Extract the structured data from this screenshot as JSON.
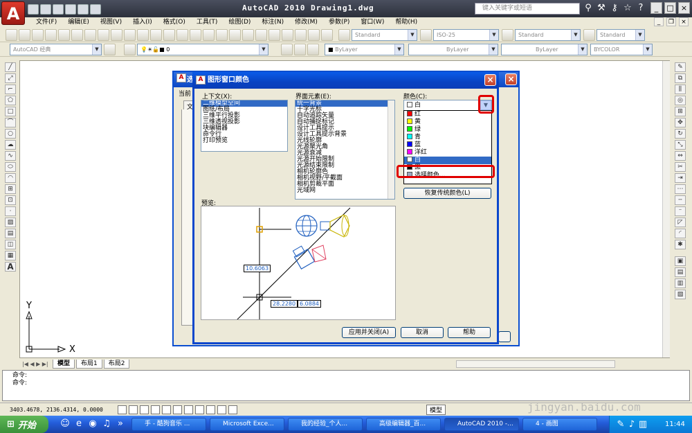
{
  "app": {
    "logo_letter": "A",
    "window_title": "AutoCAD 2010   Drawing1.dwg",
    "search_placeholder": "键入关键字或短语"
  },
  "menu": [
    "文件(F)",
    "编辑(E)",
    "视图(V)",
    "插入(I)",
    "格式(O)",
    "工具(T)",
    "绘图(D)",
    "标注(N)",
    "修改(M)",
    "参数(P)",
    "窗口(W)",
    "帮助(H)"
  ],
  "toolbar": {
    "text_style": "Standard",
    "dim_style": "ISO-25",
    "table_style": "Standard",
    "multileader_style": "Standard",
    "workspace": "AutoCAD 经典",
    "layer": "0",
    "color": "ByLayer",
    "linetype": "ByLayer",
    "lineweight": "ByLayer",
    "plotstyle": "BYCOLOR"
  },
  "layout_tabs": [
    "模型",
    "布局1",
    "布局2"
  ],
  "command_lines": [
    "命令:",
    "命令:"
  ],
  "status": {
    "coords": "3403.4678, 2136.4314, 0.0000",
    "model_label": "模型"
  },
  "axes": {
    "x": "X",
    "y": "Y"
  },
  "bg_dialog": {
    "title_fragment": "选",
    "label_fragment": "当前",
    "tab_fragment": "文"
  },
  "dialog": {
    "title": "图形窗口颜色",
    "context_label": "上下文(X):",
    "contexts": [
      "二维模型空间",
      "图纸/布局",
      "三维平行投影",
      "三维透视投影",
      "块编辑器",
      "命令行",
      "打印预览"
    ],
    "element_label": "界面元素(E):",
    "elements": [
      "统一背景",
      "十字光标",
      "自动追踪矢量",
      "自动捕捉标记",
      "设计工具提示",
      "设计工具提示背景",
      "光线轮廓",
      "光源聚光角",
      "光源衰减",
      "光源开始限制",
      "光源结束限制",
      "相机轮廓色",
      "相机视野/平截面",
      "相机剪裁平面",
      "光域网"
    ],
    "color_label": "颜色(C):",
    "current_color": "白",
    "color_options": [
      {
        "name": "红",
        "swatch": "#ff0000"
      },
      {
        "name": "黄",
        "swatch": "#ffff00"
      },
      {
        "name": "绿",
        "swatch": "#00ff00"
      },
      {
        "name": "青",
        "swatch": "#00ffff"
      },
      {
        "name": "蓝",
        "swatch": "#0000ff"
      },
      {
        "name": "洋红",
        "swatch": "#ff00ff"
      },
      {
        "name": "白",
        "swatch": "#ffffff"
      },
      {
        "name": "黑",
        "swatch": "#000000"
      },
      {
        "name": "选择颜色...",
        "swatch": "#9aa6c0"
      }
    ],
    "highlighted_color": "白",
    "restore_btn": "恢复传统颜色(L)",
    "preview_label": "预览:",
    "preview_values": [
      "10.6063",
      "28.2280",
      "6.0884"
    ],
    "buttons": {
      "apply_close": "应用并关闭(A)",
      "cancel": "取消",
      "help": "帮助"
    }
  },
  "taskbar": {
    "start": "开始",
    "tasks": [
      "手 - 酷狗音乐 ...",
      "Microsoft Exce...",
      "我的经验_个人...",
      "高级编辑器_百...",
      "AutoCAD 2010 -...",
      "4 - 画图"
    ],
    "clock": "11:44"
  },
  "watermark": "jingyan.baidu.com"
}
